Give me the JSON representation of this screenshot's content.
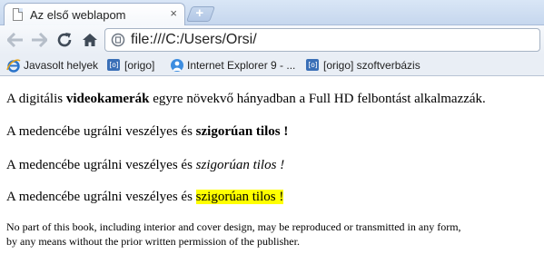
{
  "browser": {
    "tab_title": "Az első weblapom",
    "tab_close": "×",
    "new_tab": "+",
    "url": "file:///C:/Users/Orsi/"
  },
  "bookmarks": [
    {
      "label": "Javasolt helyek",
      "icon": "ie-icon"
    },
    {
      "label": "[origo]",
      "icon": "origo-icon"
    },
    {
      "label": "Internet Explorer 9 - ...",
      "icon": "ie9-icon"
    },
    {
      "label": "[origo] szoftverbázis",
      "icon": "origo-icon"
    }
  ],
  "icon_text": {
    "origo": "[o]"
  },
  "content": {
    "p1": {
      "before": "A digitális ",
      "bold": "videokamerák",
      "after": " egyre növekvő hányadban a Full HD felbontást alkalmazzák."
    },
    "p2": {
      "before": "A medencébe ugrálni veszélyes és ",
      "strong": "szigorúan tilos !"
    },
    "p3": {
      "before": "A medencébe ugrálni veszélyes és ",
      "em": "szigorúan tilos !"
    },
    "p4": {
      "before": "A medencébe ugrálni veszélyes és ",
      "mark": "szigorúan tilos !"
    },
    "small_line1": "No part of this book, including interior and cover design, may be reproduced or transmitted in any form,",
    "small_line2": "by any means without the prior written permission of the publisher."
  },
  "colors": {
    "highlight": "#ffff00",
    "tabstrip": "#d9e6f6"
  }
}
